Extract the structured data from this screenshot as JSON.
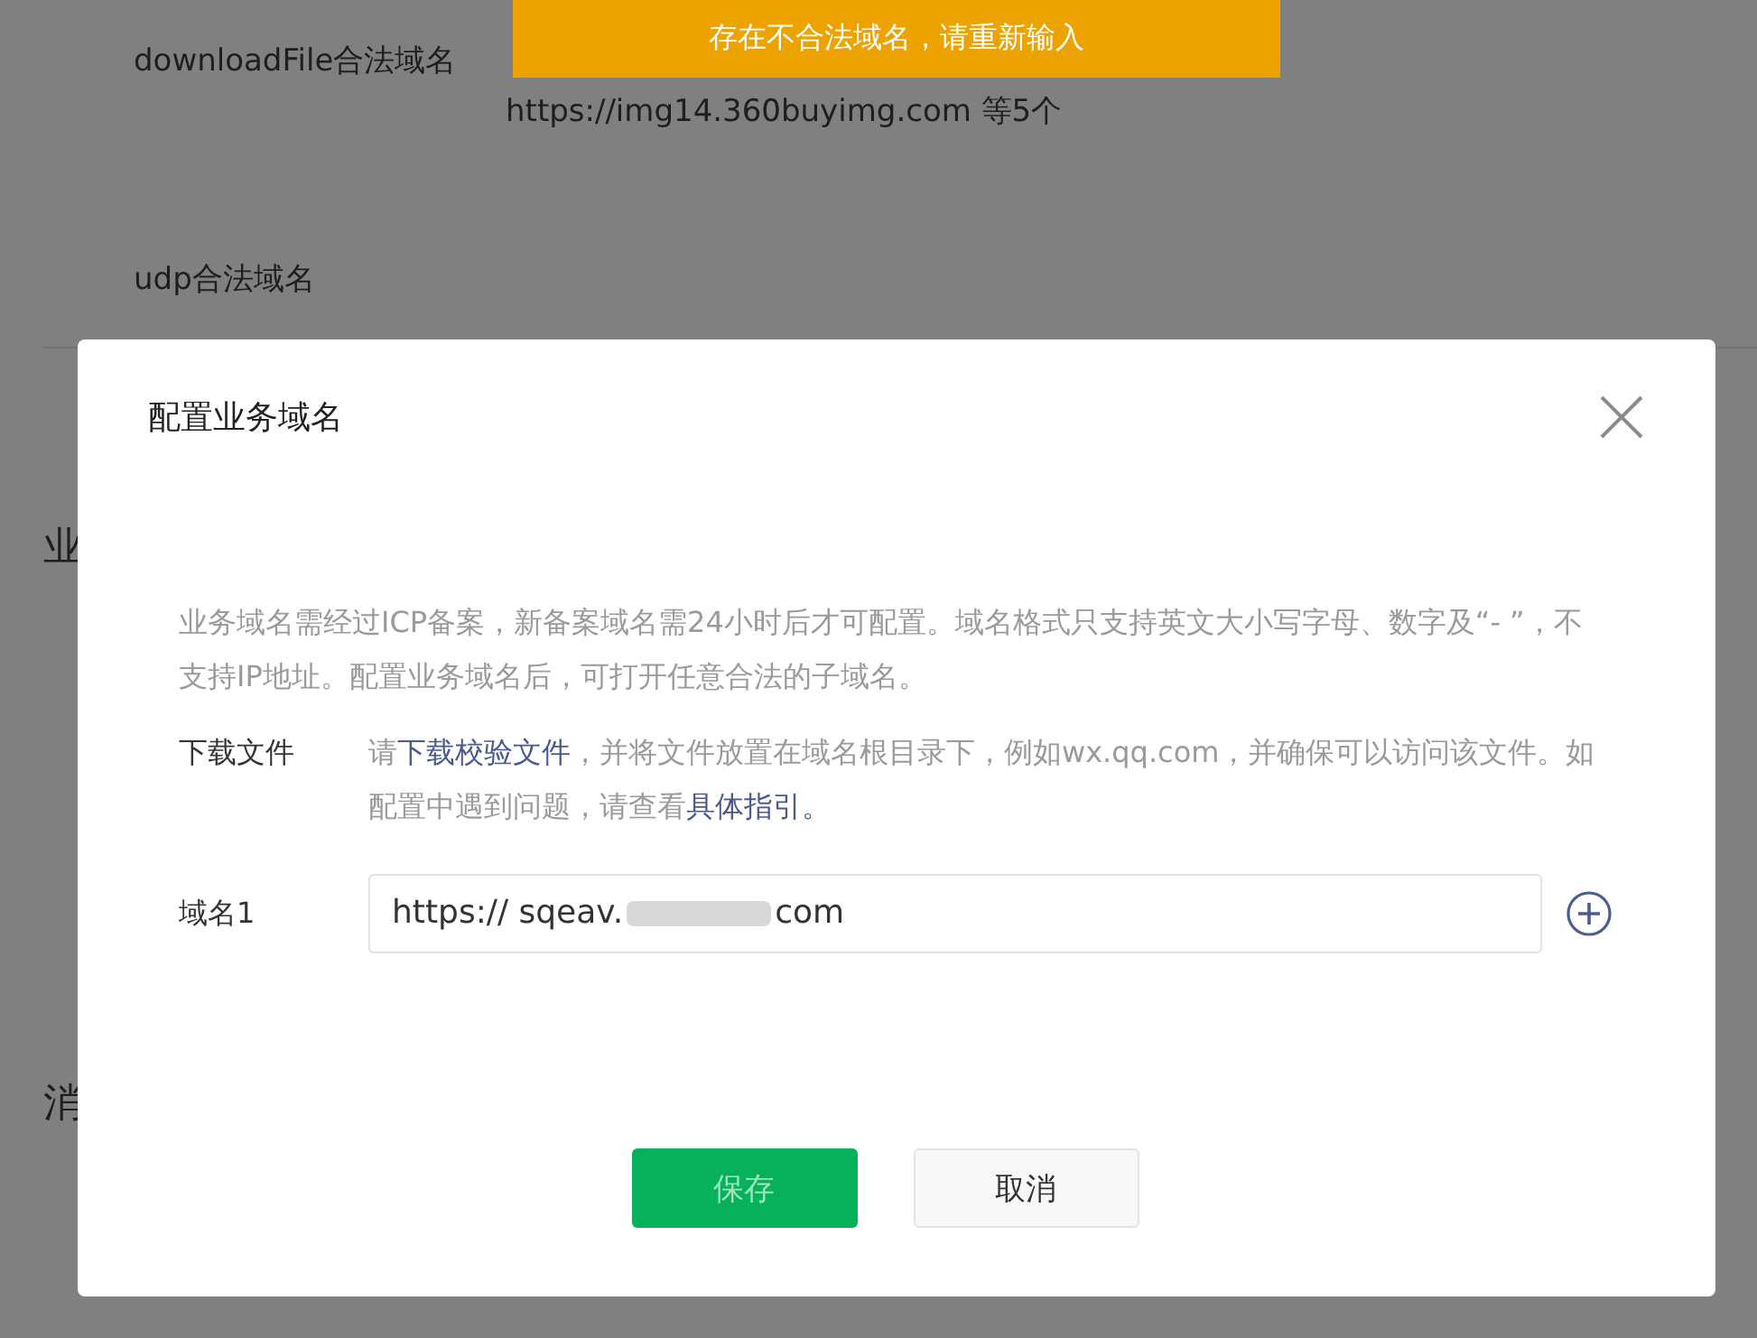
{
  "background": {
    "rows": [
      {
        "label": "downloadFile合法域名",
        "value": "https://img14.360buyimg.com 等5个"
      },
      {
        "label": "udp合法域名"
      }
    ],
    "section_titles": [
      "业",
      "消"
    ]
  },
  "toast": {
    "text": "存在不合法域名，请重新输入"
  },
  "dialog": {
    "title": "配置业务域名",
    "description": "业务域名需经过ICP备案，新备案域名需24小时后才可配置。域名格式只支持英文大小写字母、数字及“- ”，不支持IP地址。配置业务域名后，可打开任意合法的子域名。",
    "download": {
      "label": "下载文件",
      "parts": [
        {
          "kind": "text",
          "text": "请"
        },
        {
          "kind": "link",
          "text": "下载校验文件"
        },
        {
          "kind": "text",
          "text": "，并将文件放置在域名根目录下，例如wx.qq.com，并确保可以访问该文件。如配置中遇到问题，请查看"
        },
        {
          "kind": "link",
          "text": "具体指引。"
        }
      ]
    },
    "domains": [
      {
        "label": "域名1",
        "value_start": "https:// sqeav.",
        "value_end": "com"
      }
    ],
    "buttons": [
      {
        "label": "保存",
        "kind": "primary",
        "disabled": true
      },
      {
        "label": "取消",
        "kind": "default",
        "disabled": false
      }
    ]
  }
}
